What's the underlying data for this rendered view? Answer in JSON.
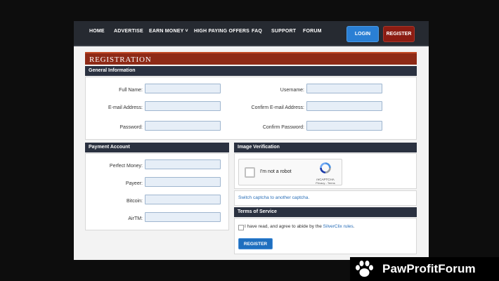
{
  "nav": {
    "items": [
      "HOME",
      "ADVERTISE",
      "EARN MONEY ˅",
      "HIGH PAYING OFFERS",
      "FAQ",
      "SUPPORT",
      "FORUM"
    ],
    "login": "LOGIN",
    "register": "REGISTER"
  },
  "registration": {
    "title": "REGISTRATION",
    "general": {
      "title": "General Information",
      "full_name": "Full Name:",
      "email": "E-mail Address:",
      "password": "Password:",
      "username": "Username:",
      "confirm_email": "Confirm E-mail Address:",
      "confirm_password": "Confirm Password:"
    },
    "payment": {
      "title": "Payment Account",
      "perfect_money": "Perfect Money:",
      "payeer": "Payeer:",
      "bitcoin": "Bitcoin:",
      "airtm": "AirTM:"
    },
    "verification": {
      "title": "Image Verification",
      "captcha_text": "I'm not a robot",
      "captcha_brand": "reCAPTCHA",
      "captcha_links": "Privacy - Terms",
      "switch_link": "Switch captcha to another captcha."
    },
    "tos": {
      "title": "Terms of Service",
      "text": "I have read, and agree to abide by the ",
      "link": "SilverClix rules",
      "period": ".",
      "submit": "REGISTER"
    }
  },
  "watermark": {
    "text": "PawProfitForum"
  }
}
